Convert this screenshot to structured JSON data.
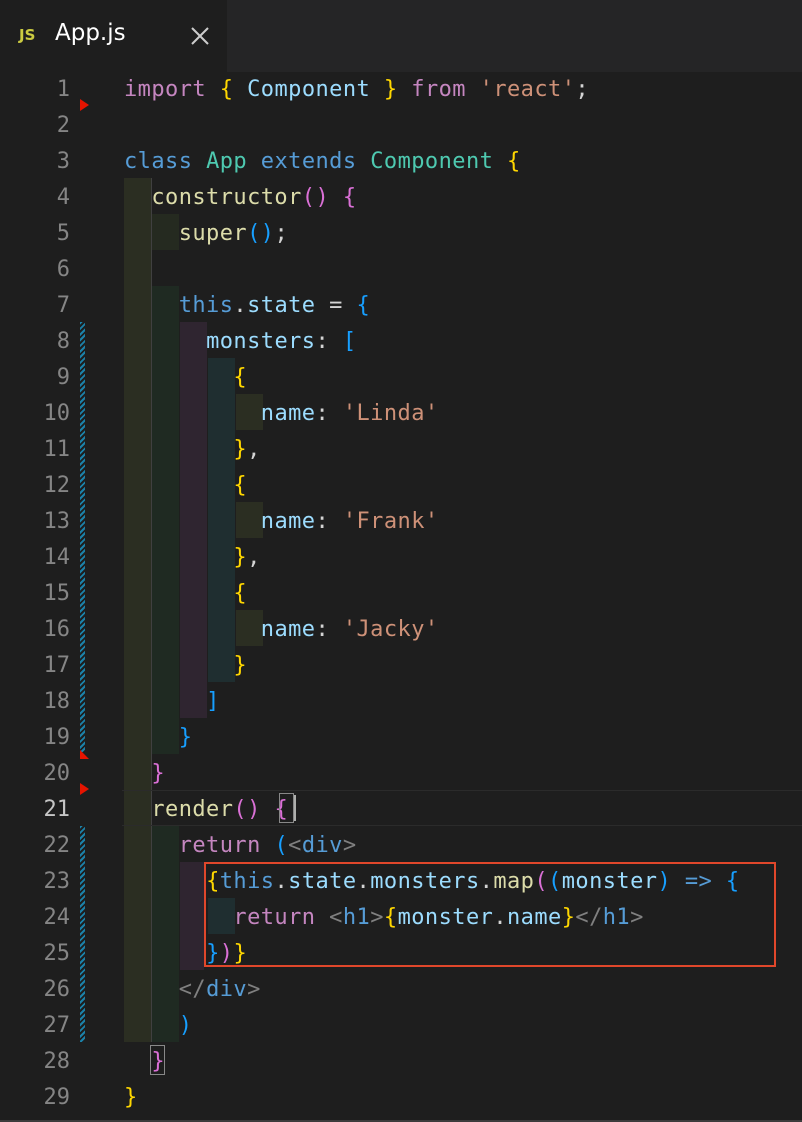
{
  "tab": {
    "icon": "JS",
    "title": "App.js",
    "close_icon": "close-icon"
  },
  "colors": {
    "keyword": "#c586c0",
    "storage": "#569cd6",
    "class": "#4ec9b0",
    "variable": "#9cdcfe",
    "function": "#dcdcaa",
    "string": "#ce9178",
    "bracket1": "#ffd700",
    "bracket2": "#da70d6",
    "bracket3": "#179fff",
    "highlight_box": "#e0472b",
    "line_number": "#858585",
    "background": "#1e1e1e"
  },
  "active_line": 21,
  "lines": [
    {
      "n": 1,
      "tokens": [
        [
          "kw",
          "import"
        ],
        [
          "pn",
          " "
        ],
        [
          "b1",
          "{"
        ],
        [
          "pn",
          " "
        ],
        [
          "var",
          "Component"
        ],
        [
          "pn",
          " "
        ],
        [
          "b1",
          "}"
        ],
        [
          "pn",
          " "
        ],
        [
          "kw",
          "from"
        ],
        [
          "pn",
          " "
        ],
        [
          "str",
          "'react'"
        ],
        [
          "pn",
          ";"
        ]
      ]
    },
    {
      "n": 2,
      "tokens": []
    },
    {
      "n": 3,
      "tokens": [
        [
          "sk",
          "class"
        ],
        [
          "pn",
          " "
        ],
        [
          "cls",
          "App"
        ],
        [
          "pn",
          " "
        ],
        [
          "sk",
          "extends"
        ],
        [
          "pn",
          " "
        ],
        [
          "cls",
          "Component"
        ],
        [
          "pn",
          " "
        ],
        [
          "b1",
          "{"
        ]
      ]
    },
    {
      "n": 4,
      "tokens": [
        [
          "pn",
          "  "
        ],
        [
          "fn",
          "constructor"
        ],
        [
          "b2",
          "()"
        ],
        [
          "pn",
          " "
        ],
        [
          "b2",
          "{"
        ]
      ]
    },
    {
      "n": 5,
      "tokens": [
        [
          "pn",
          "    "
        ],
        [
          "fn",
          "super"
        ],
        [
          "b3",
          "()"
        ],
        [
          "pn",
          ";"
        ]
      ]
    },
    {
      "n": 6,
      "tokens": []
    },
    {
      "n": 7,
      "tokens": [
        [
          "pn",
          "    "
        ],
        [
          "sk",
          "this"
        ],
        [
          "pn",
          "."
        ],
        [
          "var",
          "state"
        ],
        [
          "pn",
          " = "
        ],
        [
          "b3",
          "{"
        ]
      ]
    },
    {
      "n": 8,
      "tokens": [
        [
          "pn",
          "      "
        ],
        [
          "var",
          "monsters"
        ],
        [
          "pn",
          ": "
        ],
        [
          "b3",
          "["
        ]
      ]
    },
    {
      "n": 9,
      "tokens": [
        [
          "pn",
          "        "
        ],
        [
          "b1",
          "{"
        ]
      ]
    },
    {
      "n": 10,
      "tokens": [
        [
          "pn",
          "          "
        ],
        [
          "var",
          "name"
        ],
        [
          "pn",
          ": "
        ],
        [
          "str",
          "'Linda'"
        ]
      ]
    },
    {
      "n": 11,
      "tokens": [
        [
          "pn",
          "        "
        ],
        [
          "b1",
          "}"
        ],
        [
          "pn",
          ","
        ]
      ]
    },
    {
      "n": 12,
      "tokens": [
        [
          "pn",
          "        "
        ],
        [
          "b1",
          "{"
        ]
      ]
    },
    {
      "n": 13,
      "tokens": [
        [
          "pn",
          "          "
        ],
        [
          "var",
          "name"
        ],
        [
          "pn",
          ": "
        ],
        [
          "str",
          "'Frank'"
        ]
      ]
    },
    {
      "n": 14,
      "tokens": [
        [
          "pn",
          "        "
        ],
        [
          "b1",
          "}"
        ],
        [
          "pn",
          ","
        ]
      ]
    },
    {
      "n": 15,
      "tokens": [
        [
          "pn",
          "        "
        ],
        [
          "b1",
          "{"
        ]
      ]
    },
    {
      "n": 16,
      "tokens": [
        [
          "pn",
          "          "
        ],
        [
          "var",
          "name"
        ],
        [
          "pn",
          ": "
        ],
        [
          "str",
          "'Jacky'"
        ]
      ]
    },
    {
      "n": 17,
      "tokens": [
        [
          "pn",
          "        "
        ],
        [
          "b1",
          "}"
        ]
      ]
    },
    {
      "n": 18,
      "tokens": [
        [
          "pn",
          "      "
        ],
        [
          "b3",
          "]"
        ]
      ]
    },
    {
      "n": 19,
      "tokens": [
        [
          "pn",
          "    "
        ],
        [
          "b3",
          "}"
        ]
      ]
    },
    {
      "n": 20,
      "tokens": [
        [
          "pn",
          "  "
        ],
        [
          "b2",
          "}"
        ]
      ]
    },
    {
      "n": 21,
      "tokens": [
        [
          "pn",
          "  "
        ],
        [
          "fn",
          "render"
        ],
        [
          "b2",
          "()"
        ],
        [
          "pn",
          " "
        ],
        [
          "b2",
          "{"
        ]
      ]
    },
    {
      "n": 22,
      "tokens": [
        [
          "pn",
          "    "
        ],
        [
          "kw",
          "return"
        ],
        [
          "pn",
          " "
        ],
        [
          "b3",
          "("
        ],
        [
          "ang",
          "<"
        ],
        [
          "tag",
          "div"
        ],
        [
          "ang",
          ">"
        ]
      ]
    },
    {
      "n": 23,
      "tokens": [
        [
          "pn",
          "      "
        ],
        [
          "b1",
          "{"
        ],
        [
          "sk",
          "this"
        ],
        [
          "pn",
          "."
        ],
        [
          "var",
          "state"
        ],
        [
          "pn",
          "."
        ],
        [
          "var",
          "monsters"
        ],
        [
          "pn",
          "."
        ],
        [
          "fn",
          "map"
        ],
        [
          "b2",
          "("
        ],
        [
          "b3",
          "("
        ],
        [
          "var",
          "monster"
        ],
        [
          "b3",
          ")"
        ],
        [
          "pn",
          " "
        ],
        [
          "sk",
          "=>"
        ],
        [
          "pn",
          " "
        ],
        [
          "b3",
          "{"
        ]
      ]
    },
    {
      "n": 24,
      "tokens": [
        [
          "pn",
          "        "
        ],
        [
          "kw",
          "return"
        ],
        [
          "pn",
          " "
        ],
        [
          "ang",
          "<"
        ],
        [
          "tag",
          "h1"
        ],
        [
          "ang",
          ">"
        ],
        [
          "b1",
          "{"
        ],
        [
          "var",
          "monster"
        ],
        [
          "pn",
          "."
        ],
        [
          "var",
          "name"
        ],
        [
          "b1",
          "}"
        ],
        [
          "ang",
          "</"
        ],
        [
          "tag",
          "h1"
        ],
        [
          "ang",
          ">"
        ]
      ]
    },
    {
      "n": 25,
      "tokens": [
        [
          "pn",
          "      "
        ],
        [
          "b3",
          "}"
        ],
        [
          "b2",
          ")"
        ],
        [
          "b1",
          "}"
        ]
      ]
    },
    {
      "n": 26,
      "tokens": [
        [
          "pn",
          "    "
        ],
        [
          "ang",
          "</"
        ],
        [
          "tag",
          "div"
        ],
        [
          "ang",
          ">"
        ]
      ]
    },
    {
      "n": 27,
      "tokens": [
        [
          "pn",
          "    "
        ],
        [
          "b3",
          ")"
        ]
      ]
    },
    {
      "n": 28,
      "tokens": [
        [
          "pn",
          "  "
        ],
        [
          "b2",
          "}"
        ]
      ]
    },
    {
      "n": 29,
      "tokens": [
        [
          "b1",
          "}"
        ]
      ]
    }
  ]
}
